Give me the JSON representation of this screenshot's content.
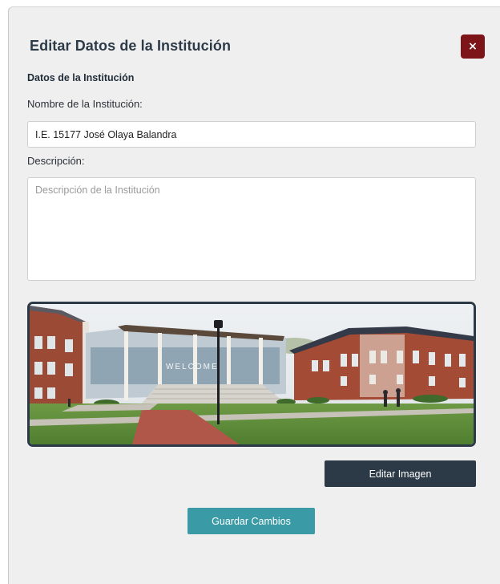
{
  "modal": {
    "title": "Editar Datos de la Institución",
    "close_label": "×"
  },
  "form": {
    "section_title": "Datos de la Institución",
    "name_label": "Nombre de la Institución:",
    "name_value": "I.E. 15177 José Olaya Balandra",
    "description_label": "Descripción:",
    "description_value": "",
    "description_placeholder": "Descripción de la Institución"
  },
  "image": {
    "alt": "Institution campus photo",
    "signage_text": "WELCOME"
  },
  "buttons": {
    "edit_image": "Editar Imagen",
    "save": "Guardar Cambios"
  },
  "colors": {
    "title_text": "#2d3a48",
    "close_button": "#7d1518",
    "dark_button": "#2c3a48",
    "accent_button": "#3a9aa6",
    "modal_background": "#efefef"
  }
}
